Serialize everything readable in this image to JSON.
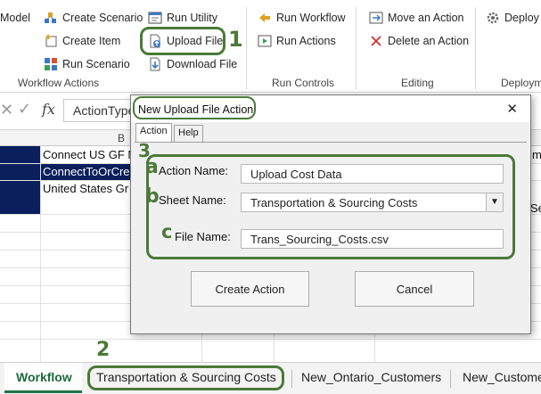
{
  "ribbon": {
    "model": "Model",
    "create_scenario": "Create Scenario",
    "run_utility": "Run Utility",
    "create_item": "Create Item",
    "upload_file": "Upload File",
    "run_scenario": "Run Scenario",
    "download_file": "Download File",
    "run_workflow": "Run Workflow",
    "run_actions": "Run Actions",
    "move_action": "Move an Action",
    "delete_action": "Delete an Action",
    "deploy": "Deploy",
    "group_workflow_actions": "Workflow Actions",
    "group_run_controls": "Run Controls",
    "group_editing": "Editing",
    "group_deployment": "Deploym"
  },
  "formula_bar": {
    "fx": "fx",
    "value": "ActionType"
  },
  "sheet": {
    "column_b": "B",
    "cells": [
      "Connect US GF M",
      "ConnectToOrCre",
      "United States Gr"
    ],
    "right_cells": [
      "m",
      "Se"
    ]
  },
  "dialog": {
    "title": "New Upload File Action",
    "close": "✕",
    "tab_action": "Action",
    "tab_help": "Help",
    "action_name_label": "Action Name:",
    "action_name_value": "Upload Cost Data",
    "sheet_name_label": "Sheet Name:",
    "sheet_name_value": "Transportation & Sourcing Costs",
    "file_name_label": "File Name:",
    "file_name_value": "Trans_Sourcing_Costs.csv",
    "create_button": "Create Action",
    "cancel_button": "Cancel"
  },
  "tabs": {
    "workflow": "Workflow",
    "transport": "Transportation & Sourcing Costs",
    "ontario": "New_Ontario_Customers",
    "customers": "New_Custome"
  },
  "annotations": {
    "n1": "1",
    "n2": "2",
    "n3": "3",
    "na": "a",
    "nb": "b",
    "nc": "c"
  },
  "colors": {
    "accent_green": "#4a7a38",
    "navy": "#0a1f5c"
  }
}
